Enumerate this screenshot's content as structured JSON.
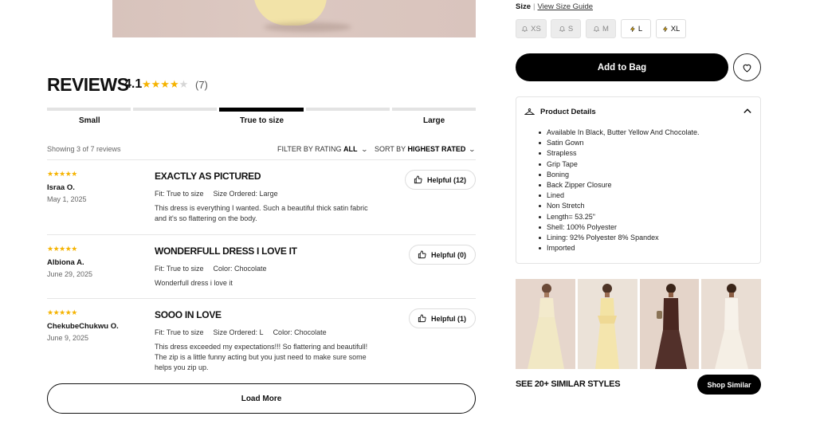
{
  "reviews": {
    "title": "REVIEWS",
    "average": "4.1",
    "stars": "★★★★",
    "stars_off": "★",
    "count": "(7)",
    "fit_labels": {
      "small": "Small",
      "true": "True to size",
      "large": "Large"
    },
    "showing": "Showing 3 of 7 reviews",
    "filter_prefix": "FILTER BY RATING",
    "filter_value": "ALL",
    "sort_prefix": "SORT BY",
    "sort_value": "HIGHEST RATED",
    "load_more": "Load More",
    "items": [
      {
        "stars": "★★★★★",
        "name": "Israa O.",
        "date": "May 1, 2025",
        "title": "EXACTLY AS PICTURED",
        "fit": "Fit: True to size",
        "extra1": "Size Ordered: Large",
        "extra2": "",
        "body": "This dress is everything I wanted. Such a beautiful thick satin fabric and it's so flattering on the body.",
        "helpful": "Helpful (12)"
      },
      {
        "stars": "★★★★★",
        "name": "Albiona A.",
        "date": "June 29, 2025",
        "title": "WONDERFULL DRESS I LOVE IT",
        "fit": "Fit: True to size",
        "extra1": "Color: Chocolate",
        "extra2": "",
        "body": "Wonderfull dress i love it",
        "helpful": "Helpful (0)"
      },
      {
        "stars": "★★★★★",
        "name": "ChekubeChukwu O.",
        "date": "June 9, 2025",
        "title": "SOOO IN LOVE",
        "fit": "Fit: True to size",
        "extra1": "Size Ordered: L",
        "extra2": "Color: Chocolate",
        "body": "This dress exceeded my expectations!!! So flattering and beautifull! The zip is a little funny acting but you just need to make sure some helps you zip up.",
        "helpful": "Helpful (1)"
      }
    ]
  },
  "product": {
    "size_label": "Size",
    "size_sep": "|",
    "size_guide": "View Size Guide",
    "sizes": [
      {
        "label": "XS",
        "available": false,
        "icon": "bell-icon"
      },
      {
        "label": "S",
        "available": false,
        "icon": "bell-icon"
      },
      {
        "label": "M",
        "available": false,
        "icon": "bell-icon"
      },
      {
        "label": "L",
        "available": true,
        "icon": "bolt-icon"
      },
      {
        "label": "XL",
        "available": true,
        "icon": "bolt-icon"
      }
    ],
    "add_to_bag": "Add to Bag",
    "details_title": "Product Details",
    "details": [
      "Available In Black, Butter Yellow And Chocolate.",
      "Satin Gown",
      "Strapless",
      "Grip Tape",
      "Boning",
      "Back Zipper Closure",
      "Lined",
      "Non Stretch",
      "Length= 53.25\"",
      "Shell: 100% Polyester",
      "Lining: 92% Polyester 8% Spandex",
      "Imported"
    ],
    "similar_title": "SEE 20+ SIMILAR STYLES",
    "shop_similar": "Shop Similar"
  },
  "colors": {
    "accent": "#000000",
    "star": "#f5b301",
    "butter_yellow": "#f2e3a8",
    "chocolate": "#4a2720"
  }
}
